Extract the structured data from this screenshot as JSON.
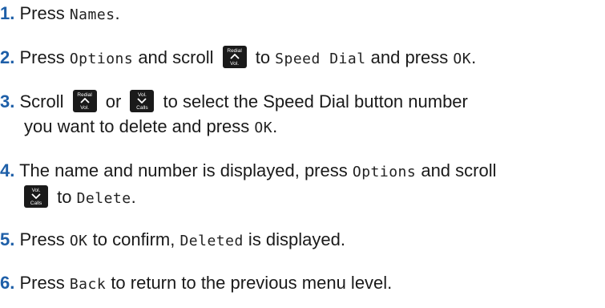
{
  "colors": {
    "step_number": "#1e5fa8",
    "key_bg": "#1a1a1a"
  },
  "keys": {
    "redial_vol_up": {
      "top": "Redial",
      "bottom": "Vol."
    },
    "vol_calls_down": {
      "top": "Vol.",
      "bottom": "Calls"
    }
  },
  "steps": [
    {
      "number": "1.",
      "t1": "Press ",
      "s1": "Names",
      "t2": "."
    },
    {
      "number": "2.",
      "t1": "Press ",
      "s1": "Options",
      "t2": " and scroll ",
      "t3": " to ",
      "s2": "Speed Dial",
      "t4": " and press ",
      "s3": "OK",
      "t5": "."
    },
    {
      "number": "3.",
      "t1": "Scroll ",
      "t2": " or ",
      "t3": " to select the Speed Dial button number",
      "t4": "you want to delete and press ",
      "s1": "OK",
      "t5": "."
    },
    {
      "number": "4.",
      "t1": "The name and number is displayed, press ",
      "s1": "Options",
      "t2": " and scroll",
      "t3": " to ",
      "s2": "Delete",
      "t4": "."
    },
    {
      "number": "5.",
      "t1": "Press ",
      "s1": "OK",
      "t2": " to confirm, ",
      "s2": "Deleted",
      "t3": " is displayed."
    },
    {
      "number": "6.",
      "t1": "Press ",
      "s1": "Back",
      "t2": " to return to the previous menu level."
    }
  ]
}
